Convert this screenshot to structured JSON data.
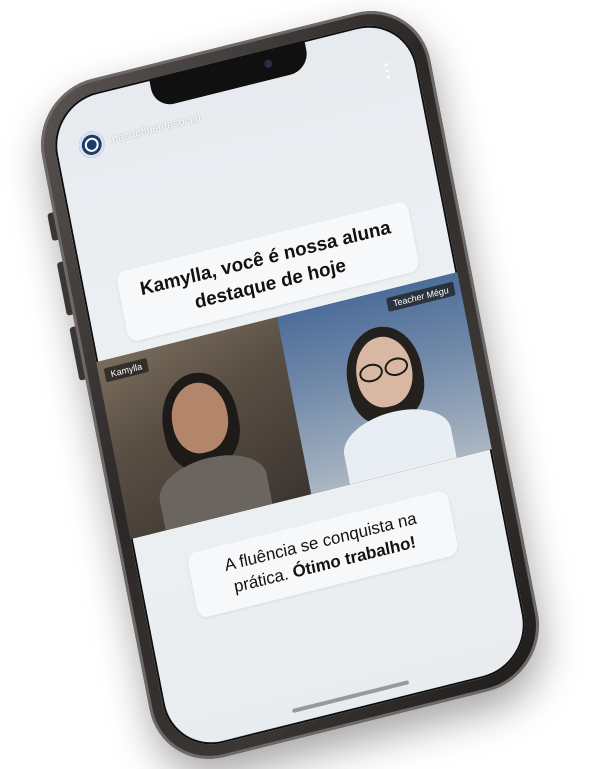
{
  "story": {
    "account_name": "nacaofluentesocial",
    "headline": "Kamylla, você é nossa aluna destaque de hoje",
    "footer_part1": "A fluência se conquista na prática.",
    "footer_part2": "Ótimo trabalho!"
  },
  "video_call": {
    "left_participant": "Kamylla",
    "right_participant": "Teacher Mégu"
  },
  "icons": {
    "avatar": "profile-avatar-icon",
    "more": "more-vertical-icon"
  },
  "colors": {
    "screen_background": "#eceff2",
    "card_background": "#f7f8fa",
    "avatar": "#1f3b6a"
  }
}
